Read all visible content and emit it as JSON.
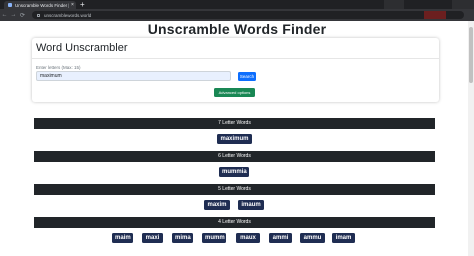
{
  "browser": {
    "tab_title": "Unscramble Words Finder | Wor",
    "tab_close": "×",
    "new_tab": "+",
    "url": "unscramblewords.world",
    "nav": {
      "back": "←",
      "forward": "→",
      "reload": "⟳"
    }
  },
  "page": {
    "title": "Unscramble Words Finder",
    "card": {
      "title": "Word Unscrambler",
      "input_label": "Enter letters (Max: 15)",
      "input_value": "maximum",
      "search_label": "Search",
      "advanced_label": "Advanced options"
    },
    "sections": [
      {
        "heading": "7 Letter Words",
        "words": [
          "maximum"
        ]
      },
      {
        "heading": "6 Letter Words",
        "words": [
          "mummia"
        ]
      },
      {
        "heading": "5 Letter Words",
        "words": [
          "maxim",
          "imaum"
        ]
      },
      {
        "heading": "4 Letter Words",
        "words": [
          "maim",
          "maxi",
          "mima",
          "mumm",
          "maux",
          "ammi",
          "ammu",
          "imam"
        ]
      }
    ]
  }
}
